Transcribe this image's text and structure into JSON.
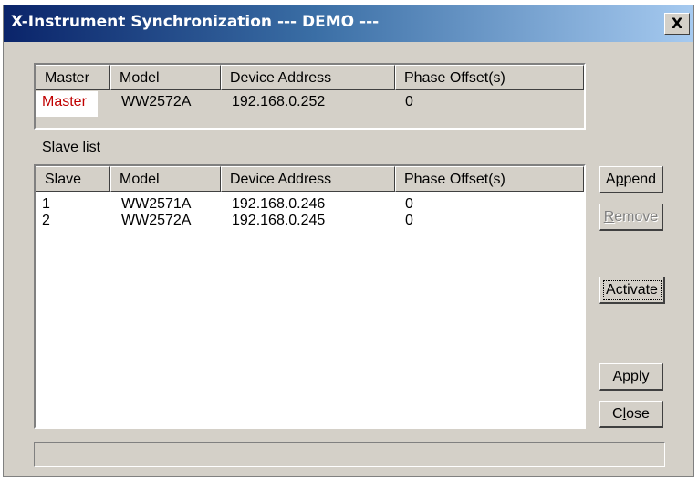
{
  "window": {
    "title": "X-Instrument Synchronization  --- DEMO ---",
    "close_label": "X"
  },
  "master_table": {
    "headers": [
      "Master",
      "Model",
      "Device Address",
      "Phase Offset(s)"
    ],
    "row": {
      "role": "Master",
      "model": "WW2572A",
      "address": "192.168.0.252",
      "offset": "0"
    }
  },
  "slave_section": {
    "label": "Slave list",
    "headers": [
      "Slave",
      "Model",
      "Device Address",
      "Phase Offset(s)"
    ],
    "rows": [
      {
        "slave": "1",
        "model": "WW2571A",
        "address": "192.168.0.246",
        "offset": "0"
      },
      {
        "slave": "2",
        "model": "WW2572A",
        "address": "192.168.0.245",
        "offset": "0"
      }
    ]
  },
  "buttons": {
    "append": {
      "pre": "A",
      "ul": "p",
      "post": "pend"
    },
    "remove": {
      "pre": "",
      "ul": "R",
      "post": "emove"
    },
    "activate": {
      "pre": "",
      "ul": "",
      "post": "Activate"
    },
    "apply": {
      "pre": "",
      "ul": "A",
      "post": "pply"
    },
    "close": {
      "pre": "C",
      "ul": "l",
      "post": "ose"
    }
  },
  "colors": {
    "title_gradient_start": "#0a246a",
    "title_gradient_end": "#a6caf0",
    "master_text": "#c00000",
    "face": "#d4d0c8"
  }
}
